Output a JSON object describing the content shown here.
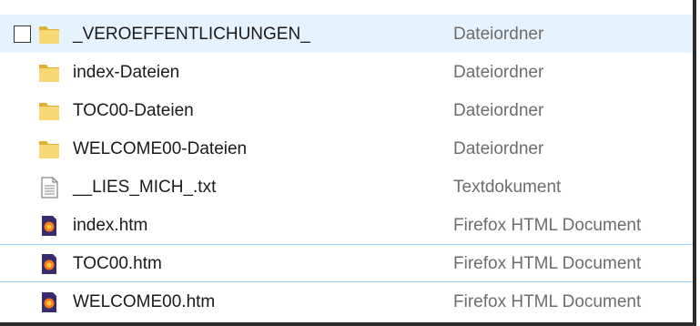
{
  "files": [
    {
      "name": "_VEROEFFENTLICHUNGEN_",
      "type": "Dateiordner",
      "icon": "folder-icon",
      "selected": true
    },
    {
      "name": "index-Dateien",
      "type": "Dateiordner",
      "icon": "folder-icon"
    },
    {
      "name": "TOC00-Dateien",
      "type": "Dateiordner",
      "icon": "folder-icon"
    },
    {
      "name": "WELCOME00-Dateien",
      "type": "Dateiordner",
      "icon": "folder-icon"
    },
    {
      "name": "__LIES_MICH_.txt",
      "type": "Textdokument",
      "icon": "text-file-icon"
    },
    {
      "name": "index.htm",
      "type": "Firefox HTML Document",
      "icon": "firefox-html-icon"
    },
    {
      "name": "TOC00.htm",
      "type": "Firefox HTML Document",
      "icon": "firefox-html-icon"
    },
    {
      "name": "WELCOME00.htm",
      "type": "Firefox HTML Document",
      "icon": "firefox-html-icon"
    }
  ],
  "colors": {
    "selection_background": "#e5f3ff",
    "hover_border": "#99d1ff",
    "folder": "#f8d775",
    "type_text": "#6d6d6d"
  }
}
